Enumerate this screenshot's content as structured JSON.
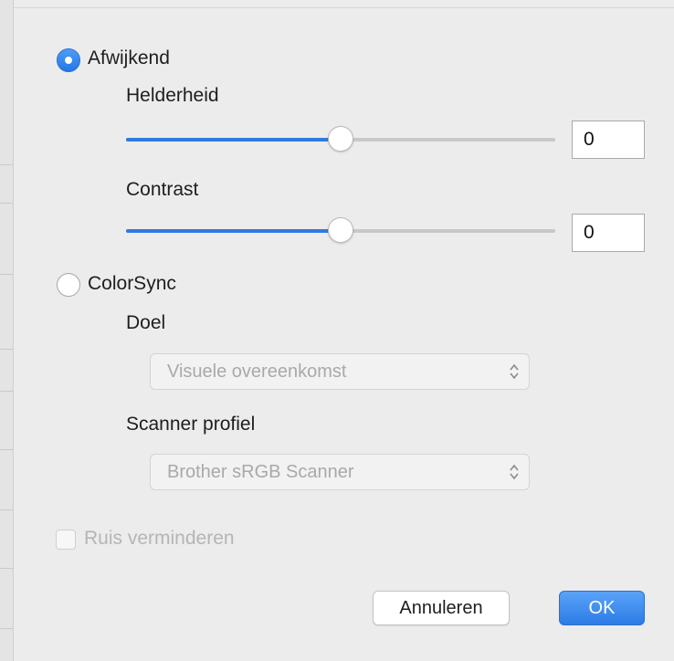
{
  "mode": {
    "custom_label": "Afwijkend",
    "colorsync_label": "ColorSync"
  },
  "brightness": {
    "label": "Helderheid",
    "value": "0",
    "slider_fraction": 0.5
  },
  "contrast": {
    "label": "Contrast",
    "value": "0",
    "slider_fraction": 0.5
  },
  "colorsync": {
    "target_label": "Doel",
    "target_value": "Visuele overeenkomst",
    "profile_label": "Scanner profiel",
    "profile_value": "Brother sRGB Scanner"
  },
  "noise": {
    "label": "Ruis verminderen",
    "checked": false
  },
  "buttons": {
    "cancel": "Annuleren",
    "ok": "OK"
  },
  "colors": {
    "accent": "#2f7ae0",
    "disabled_text": "#b5b5b5"
  }
}
